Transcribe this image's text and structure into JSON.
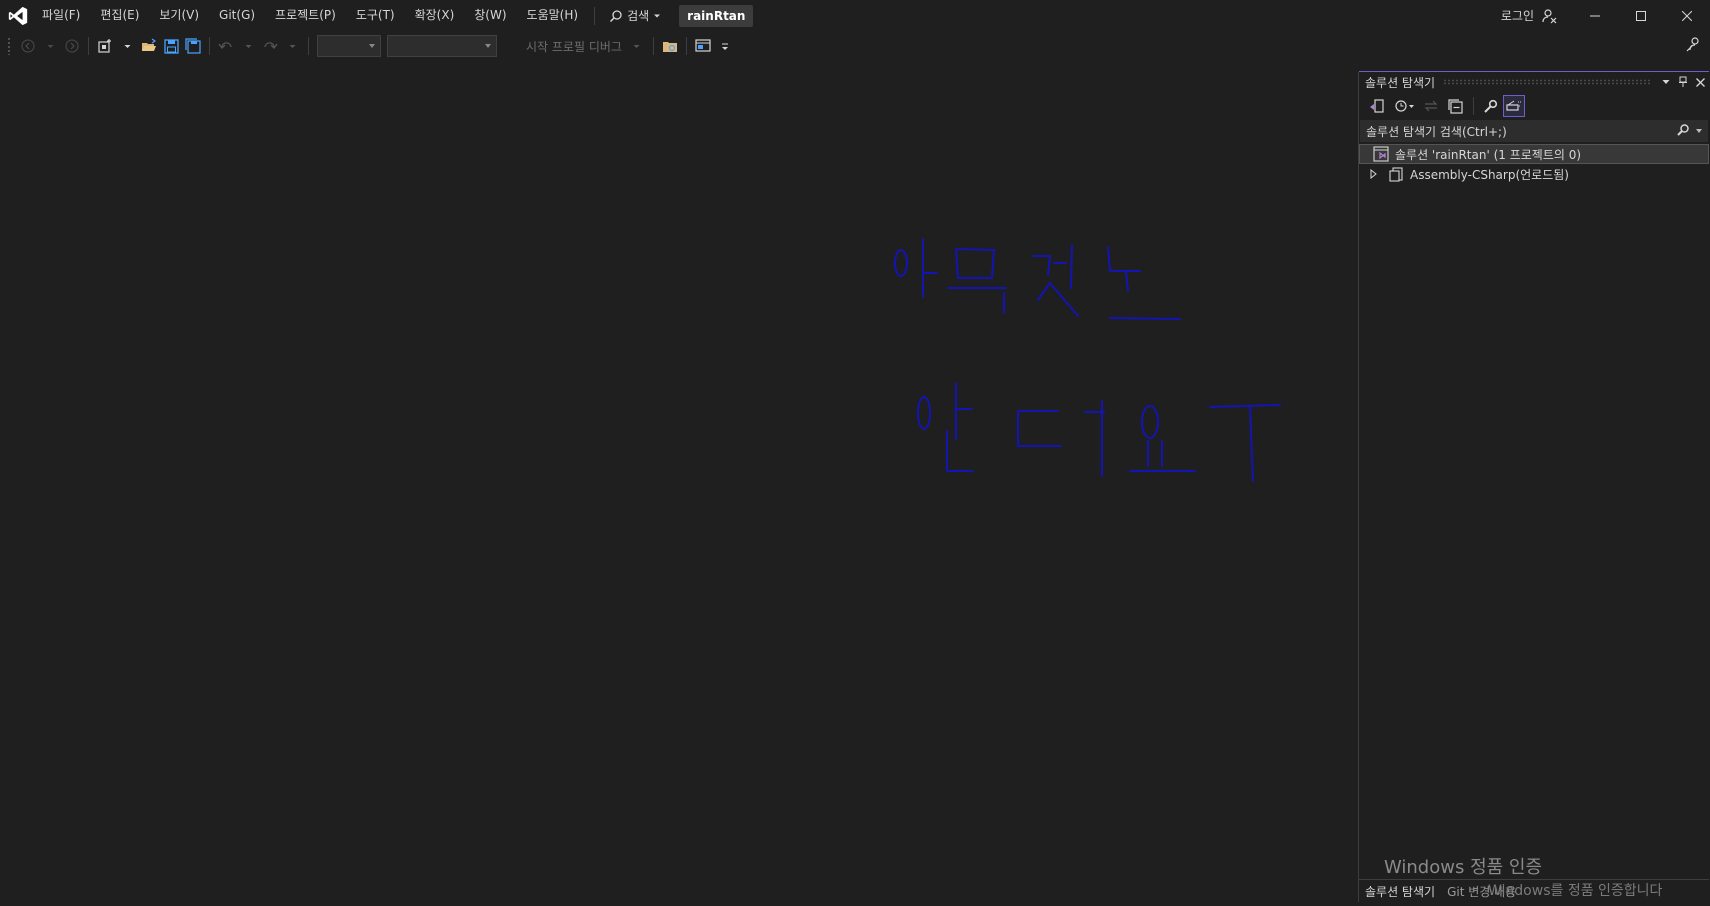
{
  "titlebar": {
    "logo_icon": "visual-studio-logo-icon",
    "menu": [
      "파일(F)",
      "편집(E)",
      "보기(V)",
      "Git(G)",
      "프로젝트(P)",
      "도구(T)",
      "확장(X)",
      "창(W)",
      "도움말(H)"
    ],
    "search_label": "검색",
    "project_name": "rainRtan",
    "login_label": "로그인"
  },
  "toolbar": {
    "debug_target_label": "시작 프로필 디버그"
  },
  "handwriting": {
    "color": "#1414b4"
  },
  "solution_explorer": {
    "title": "솔루션 탐색기",
    "search_placeholder": "솔루션 탐색기 검색(Ctrl+;)",
    "tree": [
      {
        "label": "솔루션 'rainRtan' (1 프로젝트의 0)",
        "icon": "solution-icon",
        "selected": true
      },
      {
        "label": "Assembly-CSharp(언로드됨)",
        "icon": "project-icon",
        "selected": false
      }
    ],
    "tabs": [
      "솔루션 탐색기",
      "Git 변경 내용"
    ]
  },
  "watermark": {
    "title": "Windows 정품 인증",
    "subtitle": "Windows를 정품 인증합니다"
  },
  "colors": {
    "accent": "#6c5fc7",
    "background": "#1f1f1f"
  }
}
